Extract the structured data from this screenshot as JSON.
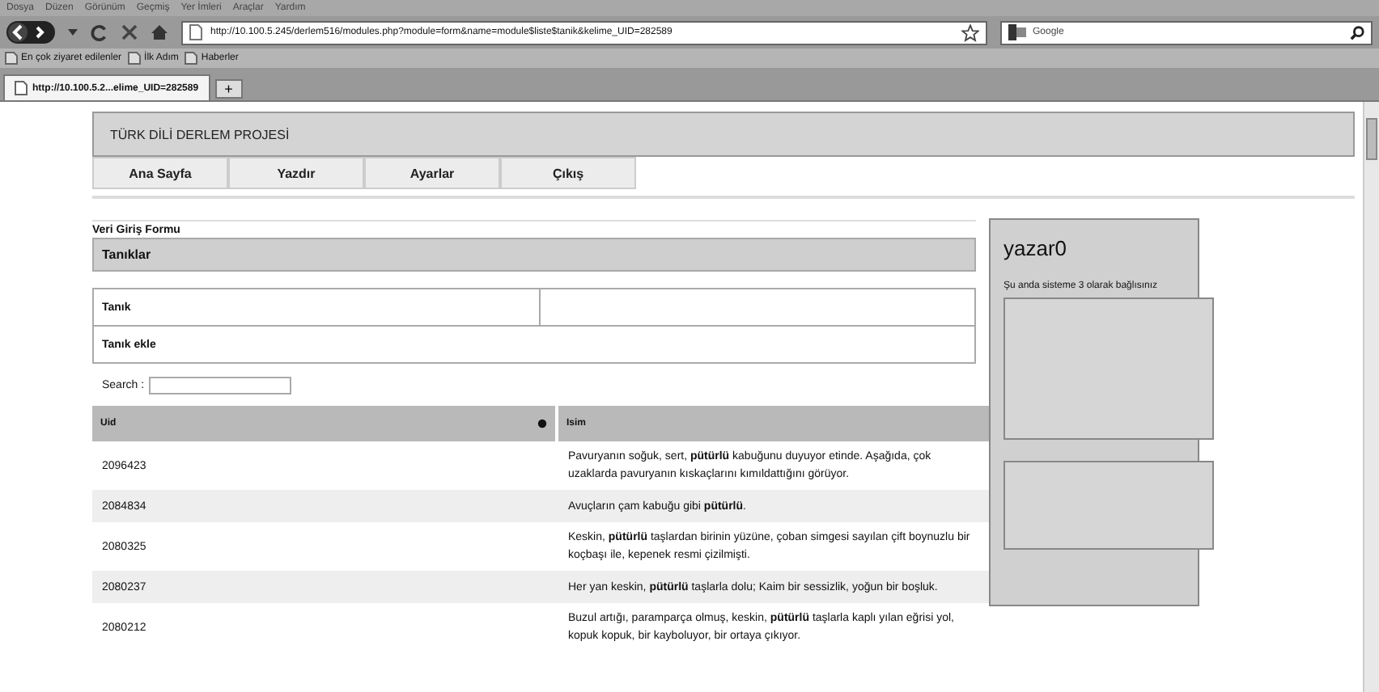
{
  "browser": {
    "menu": [
      "Dosya",
      "Düzen",
      "Görünüm",
      "Geçmiş",
      "Yer İmleri",
      "Araçlar",
      "Yardım"
    ],
    "url": "http://10.100.5.245/derlem516/modules.php?module=form&name=module$liste$tanik&kelime_UID=282589",
    "search_placeholder": "Google",
    "bookmarks": [
      "En çok ziyaret edilenler",
      "İlk Adım",
      "Haberler"
    ],
    "tabs": [
      {
        "label": "http://10.100.5.2...elime_UID=282589",
        "selected": true
      }
    ],
    "new_tab": "+"
  },
  "site": {
    "title": "TÜRK DİLİ DERLEM PROJESİ",
    "nav": [
      "Ana Sayfa",
      "Yazdır",
      "Ayarlar",
      "Çıkış"
    ]
  },
  "form": {
    "caption": "Veri Giriş Formu",
    "heading": "Tanıklar",
    "field_label": "Tanık",
    "add_link": "Tanık ekle",
    "search_label": "Search :"
  },
  "table": {
    "columns": [
      "Uid",
      "Isim"
    ],
    "rows": [
      {
        "uid": "2096423",
        "text": "Pavuryanın soğuk, sert, **pütürlü** kabuğunu duyuyor etinde. Aşağıda, çok uzaklarda pavuryanın kıskaçlarını kımıldattığını görüyor."
      },
      {
        "uid": "2084834",
        "text": "Avuçların çam kabuğu gibi **pütürlü**."
      },
      {
        "uid": "2080325",
        "text": "Keskin, **pütürlü** taşlardan birinin yüzüne, çoban simgesi sayılan çift boynuzlu bir koçbaşı ile, kepenek resmi çizilmişti."
      },
      {
        "uid": "2080237",
        "text": "Her yan keskin, **pütürlü** taşlarla dolu; Kaim bir sessizlik, yoğun bir boşluk."
      },
      {
        "uid": "2080212",
        "text": "Buzul artığı, paramparça olmuş, keskin, **pütürlü** taşlarla kaplı yılan eğrisi yol, kopuk kopuk, bir kayboluyor, bir ortaya çıkıyor."
      }
    ]
  },
  "user": {
    "name": "yazar0",
    "status": "Şu anda sisteme 3 olarak bağlısınız"
  }
}
